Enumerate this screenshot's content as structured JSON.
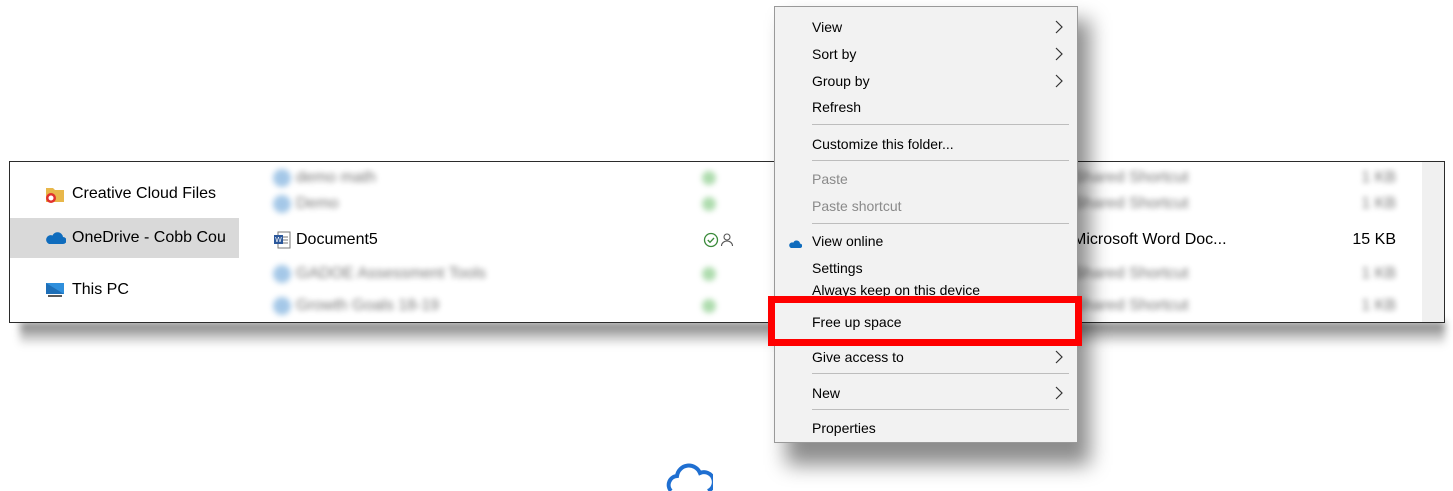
{
  "explorer": {
    "nav": [
      {
        "label": "Creative Cloud Files",
        "icon": "creative-cloud-folder-icon",
        "selected": false
      },
      {
        "label": "OneDrive - Cobb Cou",
        "icon": "onedrive-cloud-icon",
        "selected": true
      },
      {
        "label": "This PC",
        "icon": "this-pc-icon",
        "selected": false
      }
    ],
    "files": [
      {
        "name": "demo math",
        "blurred": true,
        "type": "Shared Shortcut",
        "size": "1 KB"
      },
      {
        "name": "Demo",
        "blurred": true,
        "type": "Shared Shortcut",
        "size": "1 KB"
      },
      {
        "name": "Document5",
        "blurred": false,
        "type": "Microsoft Word Doc...",
        "size": "15 KB",
        "icon": "word-document-icon"
      },
      {
        "name": "GADOE Assessment Tools",
        "blurred": true,
        "type": "Shared Shortcut",
        "size": "1 KB"
      },
      {
        "name": "Growth Goals 18-19",
        "blurred": true,
        "type": "Shared Shortcut",
        "size": "1 KB"
      }
    ]
  },
  "context_menu": {
    "items": [
      {
        "label": "View",
        "submenu": true
      },
      {
        "label": "Sort by",
        "submenu": true
      },
      {
        "label": "Group by",
        "submenu": true
      },
      {
        "label": "Refresh"
      },
      {
        "label": "Customize this folder..."
      },
      {
        "label": "Paste",
        "disabled": true
      },
      {
        "label": "Paste shortcut",
        "disabled": true
      },
      {
        "label": "View online",
        "icon": "onedrive-cloud-icon"
      },
      {
        "label": "Settings"
      },
      {
        "label": "Always keep on this device",
        "partially_hidden": true
      },
      {
        "label": "Free up space",
        "highlighted": true
      },
      {
        "label": "Give access to",
        "submenu": true
      },
      {
        "label": "New",
        "submenu": true
      },
      {
        "label": "Properties"
      }
    ]
  },
  "colors": {
    "highlight_border": "#ff0000",
    "onedrive_blue": "#0f6cbd",
    "menu_bg": "#f2f2f2"
  }
}
